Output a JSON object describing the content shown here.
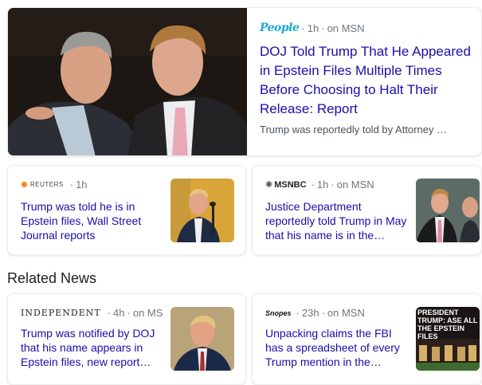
{
  "top_story": {
    "source_logo": "People",
    "time": "1h",
    "via": "on MSN",
    "headline": "DOJ Told Trump That He Appeared in Epstein Files Multiple Times Before Choosing to Halt Their Release: Report",
    "snippet": "Trump was reportedly told by Attorney …"
  },
  "cards": [
    {
      "source_logo": "REUTERS",
      "time": "1h",
      "via": "",
      "headline": "Trump was told he is in Epstein files, Wall Street Journal reports"
    },
    {
      "source_logo": "MSNBC",
      "time": "1h",
      "via": "on MSN",
      "headline": "Justice Department reportedly told Trump in May that his name is in the…"
    }
  ],
  "related": {
    "heading": "Related News",
    "cards": [
      {
        "source_logo": "INDEPENDENT",
        "time": "4h",
        "via": "on MS",
        "headline": "Trump was notified by DOJ that his name appears in Epstein files, new report…"
      },
      {
        "source_logo": "Snopes",
        "time": "23h",
        "via": "on MSN",
        "headline": "Unpacking claims the FBI has a spreadsheet of every Trump mention in the…",
        "thumb_text": "PRESIDENT TRUMP: ASE ALL THE EPSTEIN FILES"
      }
    ]
  },
  "colors": {
    "link": "#1a0dab",
    "meta": "#70757a",
    "snippet": "#4d5156"
  }
}
